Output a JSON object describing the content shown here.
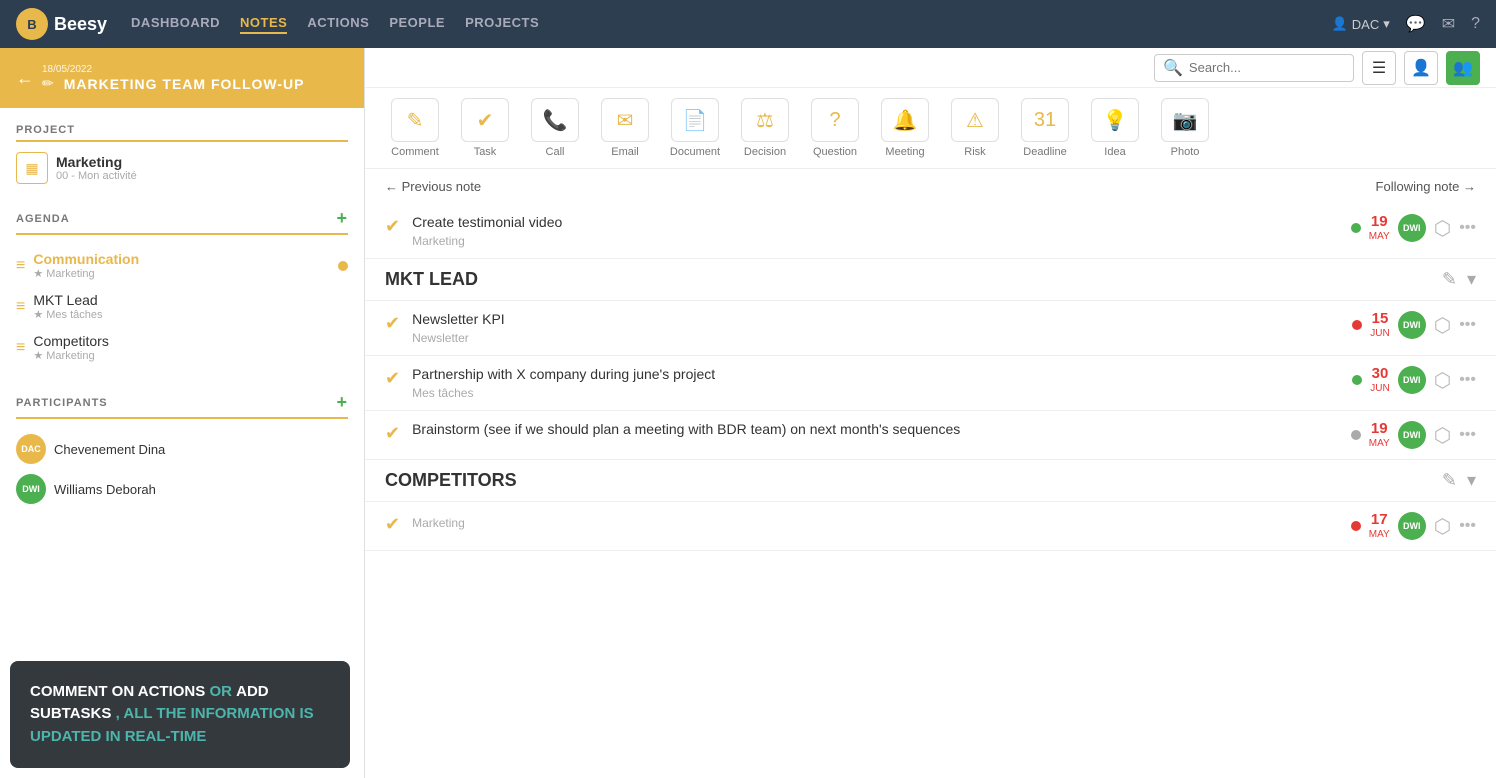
{
  "app": {
    "logo_text": "Beesy",
    "nav_items": [
      {
        "label": "DASHBOARD",
        "active": false
      },
      {
        "label": "NOTES",
        "active": true
      },
      {
        "label": "ACTIONS",
        "active": false
      },
      {
        "label": "PEOPLE",
        "active": false
      },
      {
        "label": "PROJECTS",
        "active": false
      }
    ],
    "user": "DAC",
    "icons": {
      "chat": "💬",
      "mail": "✉",
      "help": "?"
    }
  },
  "page": {
    "date": "18/05/2022",
    "title": "MARKETING TEAM FOLLOW-UP",
    "search_placeholder": "Search..."
  },
  "toolbar": [
    {
      "label": "Comment",
      "icon": "✎"
    },
    {
      "label": "Task",
      "icon": "✔"
    },
    {
      "label": "Call",
      "icon": "📞"
    },
    {
      "label": "Email",
      "icon": "✉"
    },
    {
      "label": "Document",
      "icon": "📄"
    },
    {
      "label": "Decision",
      "icon": "⚖"
    },
    {
      "label": "Question",
      "icon": "?"
    },
    {
      "label": "Meeting",
      "icon": "🔔"
    },
    {
      "label": "Risk",
      "icon": "⚠"
    },
    {
      "label": "Deadline",
      "icon": "31"
    },
    {
      "label": "Idea",
      "icon": "💡"
    },
    {
      "label": "Photo",
      "icon": "📷"
    }
  ],
  "nav": {
    "prev": "← Previous note",
    "next": "Following note →"
  },
  "sections": [
    {
      "type": "standalone",
      "items": [
        {
          "title": "Create testimonial video",
          "sub": "Marketing",
          "dot": "green",
          "date_day": "19",
          "date_month": "MAY",
          "date_color": "red",
          "avatar": "DWI",
          "avatar_color": "#4caf50"
        }
      ]
    },
    {
      "type": "group",
      "group_title": "MKT LEAD",
      "items": [
        {
          "title": "Newsletter KPI",
          "sub": "Newsletter",
          "dot": "red",
          "date_day": "15",
          "date_month": "JUN",
          "date_color": "red",
          "avatar": "DWI",
          "avatar_color": "#4caf50"
        },
        {
          "title": "Partnership with X company during june's project",
          "sub": "Mes tâches",
          "dot": "green",
          "date_day": "30",
          "date_month": "JUN",
          "date_color": "red",
          "avatar": "DWI",
          "avatar_color": "#4caf50"
        },
        {
          "title": "Brainstorm (see if we should plan a meeting with BDR team) on next month's sequences",
          "sub": "",
          "dot": "gray",
          "date_day": "19",
          "date_month": "MAY",
          "date_color": "red",
          "avatar": "DWI",
          "avatar_color": "#4caf50"
        }
      ]
    },
    {
      "type": "group",
      "group_title": "COMPETITORS",
      "items": [
        {
          "title": "",
          "sub": "Marketing",
          "dot": "red",
          "date_day": "17",
          "date_month": "MAY",
          "date_color": "red",
          "avatar": "DWI",
          "avatar_color": "#4caf50"
        }
      ]
    }
  ],
  "sidebar": {
    "project": {
      "label": "PROJECT",
      "name": "Marketing",
      "sub": "00 - Mon activité"
    },
    "agenda": {
      "label": "AGENDA",
      "items": [
        {
          "name": "Communication",
          "sub": "★ Marketing",
          "active": true,
          "dot": true
        },
        {
          "name": "MKT Lead",
          "sub": "★ Mes tâches",
          "active": false,
          "dot": false
        },
        {
          "name": "Competitors",
          "sub": "★ Marketing",
          "active": false,
          "dot": false
        }
      ]
    },
    "participants": {
      "label": "PARTICIPANTS",
      "items": [
        {
          "initials": "DAC",
          "name": "Chevenement Dina",
          "type": "dac"
        },
        {
          "initials": "DWI",
          "name": "Williams Deborah",
          "type": "dwi"
        }
      ]
    }
  },
  "tooltip": {
    "text_bold1": "COMMENT ON ACTIONS",
    "text_or": " OR ",
    "text_bold2": "ADD SUBTASKS",
    "text_normal": ", ALL THE INFORMATION IS UPDATED IN REAL-TIME"
  }
}
